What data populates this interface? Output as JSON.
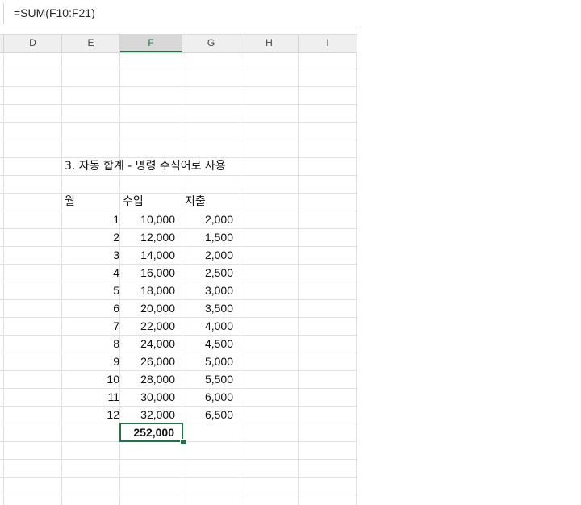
{
  "formula_bar": {
    "formula": "=SUM(F10:F21)"
  },
  "columns": [
    "D",
    "E",
    "F",
    "G",
    "H",
    "I"
  ],
  "selected_column": "F",
  "sheet": {
    "title": "3. 자동 합계 - 명령 수식어로 사용",
    "headers": {
      "month": "월",
      "income": "수입",
      "expense": "지출"
    },
    "rows": [
      {
        "month": "1",
        "income": "10,000",
        "expense": "2,000"
      },
      {
        "month": "2",
        "income": "12,000",
        "expense": "1,500"
      },
      {
        "month": "3",
        "income": "14,000",
        "expense": "2,000"
      },
      {
        "month": "4",
        "income": "16,000",
        "expense": "2,500"
      },
      {
        "month": "5",
        "income": "18,000",
        "expense": "3,000"
      },
      {
        "month": "6",
        "income": "20,000",
        "expense": "3,500"
      },
      {
        "month": "7",
        "income": "22,000",
        "expense": "4,000"
      },
      {
        "month": "8",
        "income": "24,000",
        "expense": "4,500"
      },
      {
        "month": "9",
        "income": "26,000",
        "expense": "5,000"
      },
      {
        "month": "10",
        "income": "28,000",
        "expense": "5,500"
      },
      {
        "month": "11",
        "income": "30,000",
        "expense": "6,000"
      },
      {
        "month": "12",
        "income": "32,000",
        "expense": "6,500"
      }
    ],
    "total": "252,000"
  },
  "accent_color": "#217346"
}
